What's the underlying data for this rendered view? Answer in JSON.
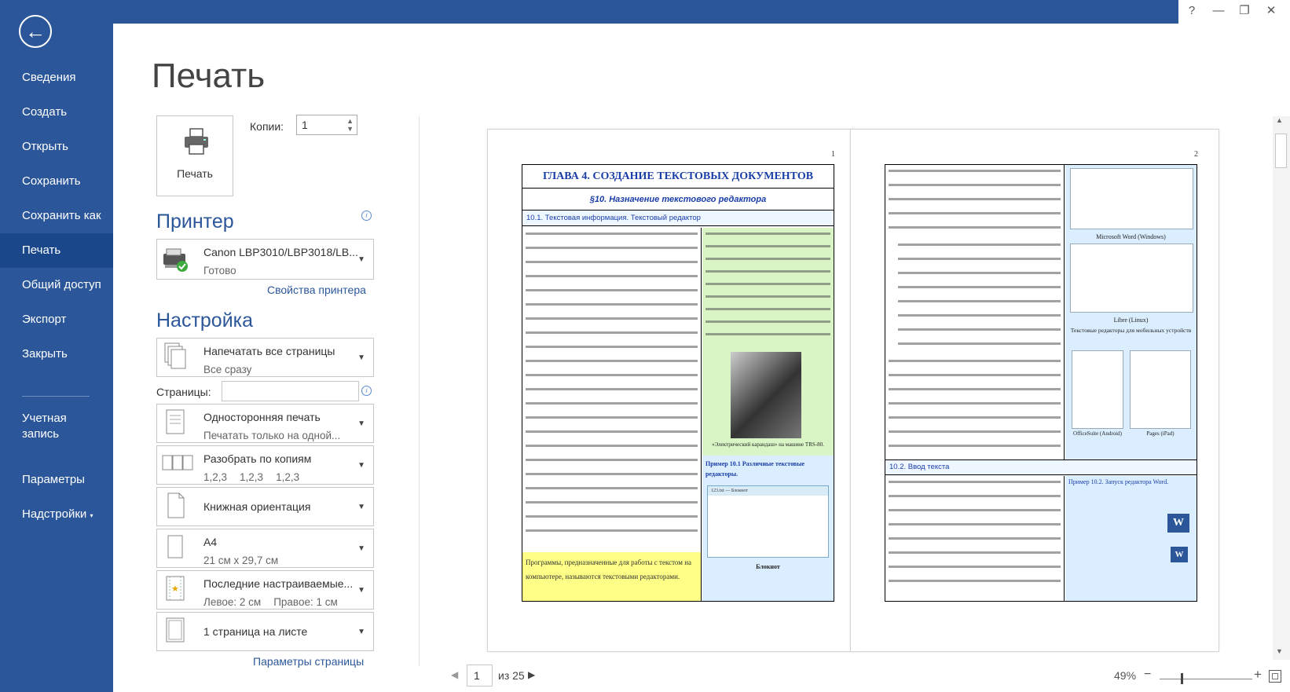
{
  "sidebar": {
    "back_icon": "back-arrow-icon",
    "items": [
      "Сведения",
      "Создать",
      "Открыть",
      "Сохранить",
      "Сохранить как",
      "Печать",
      "Общий доступ",
      "Экспорт",
      "Закрыть"
    ],
    "active": "Печать",
    "account": "Учетная запись",
    "options": "Параметры",
    "addins": "Надстройки"
  },
  "window": {
    "help": "?",
    "minimize": "—",
    "restore": "❐",
    "close": "✕"
  },
  "title": "Печать",
  "print_button": {
    "label": "Печать",
    "icon": "printer-icon"
  },
  "copies": {
    "label": "Копии:",
    "value": "1"
  },
  "printer": {
    "heading": "Принтер",
    "name": "Canon LBP3010/LBP3018/LB...",
    "status": "Готово",
    "properties_link": "Свойства принтера"
  },
  "settings": {
    "heading": "Настройка",
    "pages_label": "Страницы:",
    "pages_value": "",
    "items": [
      {
        "title": "Напечатать все страницы",
        "sub": "Все сразу",
        "icon": "all-pages-icon"
      },
      {
        "title": "Односторонняя печать",
        "sub": "Печатать только на одной...",
        "icon": "one-sided-icon"
      },
      {
        "title": "Разобрать по копиям",
        "sub_parts": [
          "1,2,3",
          "1,2,3",
          "1,2,3"
        ],
        "icon": "collate-icon"
      },
      {
        "title": "Книжная ориентация",
        "sub": "",
        "icon": "portrait-icon"
      },
      {
        "title": "A4",
        "sub": "21 см x 29,7 см",
        "icon": "paper-size-icon"
      },
      {
        "title": "Последние настраиваемые...",
        "sub_parts": [
          "Левое:  2 см",
          "Правое:  1 см"
        ],
        "icon": "margins-icon"
      },
      {
        "title": "1 страница на листе",
        "sub": "",
        "icon": "pages-per-sheet-icon"
      }
    ],
    "page_setup_link": "Параметры страницы"
  },
  "preview": {
    "page1": {
      "number": "1",
      "chapter": "ГЛАВА 4.    СОЗДАНИЕ ТЕКСТОВЫХ ДОКУМЕНТОВ",
      "section": "§10. Назначение текстового редактора",
      "subsection": "10.1.  Текстовая информация. Текстовый редактор",
      "photo_caption": "«Электрический карандаш» на машине TRS-80.",
      "example": "Пример  10.1  Различные текстовые редакторы.",
      "notepad_title": "123.txt — Блокнот",
      "notepad_caption": "Блокнот",
      "highlight_text": "Программы, предназначенные для работы с текстом на компьютере, называются текстовыми редакторами."
    },
    "page2": {
      "number": "2",
      "bullets": [
        "Создание текста (ввод текста в память компьютера).",
        "Сохранение текста на диске в виде файла.",
        "Загрузка текста из файла в оперативную память компьютера.",
        "Редактирование (изменение) созданного текста.",
        "Вывод текста на бумажный носитель."
      ],
      "captions": [
        "Microsoft Word (Windows)",
        "Libre (Linux)",
        "Текстовые редакторы для мобильных устройств",
        "OfficeSuite (Android)",
        "Pages (iPad)"
      ],
      "subsection": "10.2.  Ввод текста",
      "example": "Пример  10.2.  Запуск редактора Word."
    }
  },
  "pager": {
    "current": "1",
    "of": "из 25"
  },
  "zoom": {
    "level": "49%",
    "minus": "−",
    "plus": "+"
  },
  "colors": {
    "accent": "#2b579a",
    "active": "#19478a",
    "highlight_yellow": "#ffff88",
    "highlight_green": "#d9f5c6",
    "highlight_blue": "#dbeeff"
  }
}
